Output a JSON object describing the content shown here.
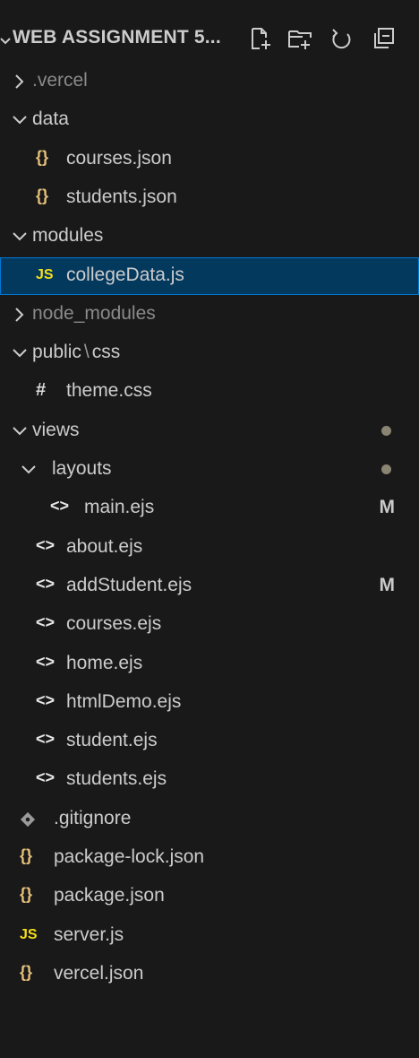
{
  "explorer": {
    "title": "WEB ASSIGNMENT 5...",
    "actions": [
      {
        "name": "new-file-icon"
      },
      {
        "name": "new-folder-icon"
      },
      {
        "name": "refresh-icon"
      },
      {
        "name": "collapse-all-icon"
      }
    ]
  },
  "tree": [
    {
      "label": ".vercel",
      "type": "folder",
      "expanded": false,
      "depth": 0,
      "dim": true
    },
    {
      "label": "data",
      "type": "folder",
      "expanded": true,
      "depth": 0
    },
    {
      "label": "courses.json",
      "type": "json",
      "depth": 1
    },
    {
      "label": "students.json",
      "type": "json",
      "depth": 1
    },
    {
      "label": "modules",
      "type": "folder",
      "expanded": true,
      "depth": 0
    },
    {
      "label": "collegeData.js",
      "type": "js",
      "depth": 1,
      "selected": true
    },
    {
      "label": "node_modules",
      "type": "folder",
      "expanded": false,
      "depth": 0,
      "dim": true
    },
    {
      "label_parts": [
        "public",
        "\\",
        "css"
      ],
      "type": "folder",
      "expanded": true,
      "depth": 0
    },
    {
      "label": "theme.css",
      "type": "css",
      "depth": 1
    },
    {
      "label": "views",
      "type": "folder",
      "expanded": true,
      "depth": 0,
      "dot": true
    },
    {
      "label": "layouts",
      "type": "folder",
      "expanded": true,
      "depth": 1,
      "dot": true
    },
    {
      "label": "main.ejs",
      "type": "ejs",
      "depth": 2,
      "badge": "M"
    },
    {
      "label": "about.ejs",
      "type": "ejs",
      "depth": 1
    },
    {
      "label": "addStudent.ejs",
      "type": "ejs",
      "depth": 1,
      "badge": "M"
    },
    {
      "label": "courses.ejs",
      "type": "ejs",
      "depth": 1
    },
    {
      "label": "home.ejs",
      "type": "ejs",
      "depth": 1
    },
    {
      "label": "htmlDemo.ejs",
      "type": "ejs",
      "depth": 1
    },
    {
      "label": "student.ejs",
      "type": "ejs",
      "depth": 1
    },
    {
      "label": "students.ejs",
      "type": "ejs",
      "depth": 1
    },
    {
      "label": ".gitignore",
      "type": "git",
      "depth": 0
    },
    {
      "label": "package-lock.json",
      "type": "json",
      "depth": 0
    },
    {
      "label": "package.json",
      "type": "json",
      "depth": 0
    },
    {
      "label": "server.js",
      "type": "js",
      "depth": 0
    },
    {
      "label": "vercel.json",
      "type": "json",
      "depth": 0
    }
  ],
  "icons": {
    "json": "{}",
    "js": "JS",
    "css": "#",
    "ejs": "<>"
  },
  "colors": {
    "background": "#191919",
    "selected_bg": "#04395e",
    "selected_border": "#0078d4",
    "js_icon": "#f5de19",
    "json_icon": "#e5c07b"
  }
}
